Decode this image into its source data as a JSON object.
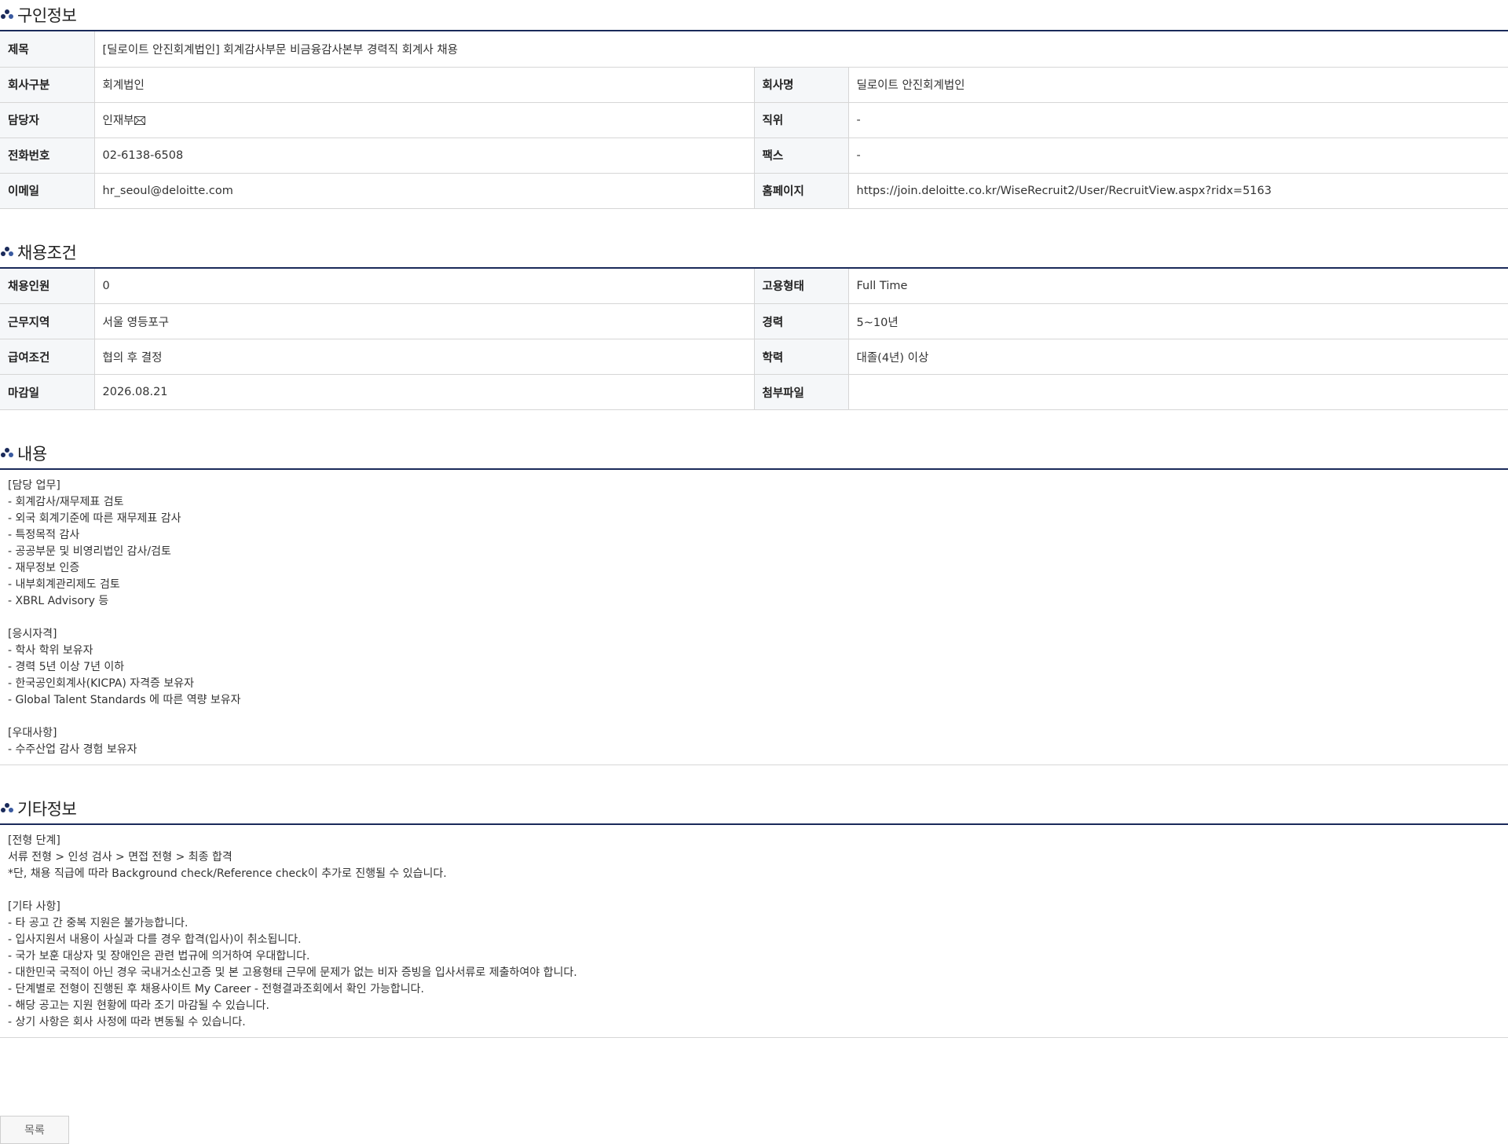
{
  "colors": {
    "accent": "#1a2a5a",
    "header_cell_bg": "#f5f7f9",
    "border": "#d6d6d6"
  },
  "icons": {
    "section_icon": "bullet-cluster-icon",
    "mail_icon": "envelope-icon"
  },
  "job_info": {
    "title": "구인정보",
    "rows": [
      {
        "label": "제목",
        "value": "[딜로이트 안진회계법인] 회계감사부문 비금융감사본부 경력직 회계사 채용"
      },
      {
        "label": "회사구분",
        "value": "회계법인",
        "label2": "회사명",
        "value2": "딜로이트 안진회계법인"
      },
      {
        "label": "담당자",
        "value": "인재부",
        "label2": "직위",
        "value2": "-"
      },
      {
        "label": "전화번호",
        "value": "02-6138-6508",
        "label2": "팩스",
        "value2": "-"
      },
      {
        "label": "이메일",
        "value": "hr_seoul@deloitte.com",
        "label2": "홈페이지",
        "value2": "https://join.deloitte.co.kr/WiseRecruit2/User/RecruitView.aspx?ridx=5163"
      }
    ]
  },
  "conditions": {
    "title": "채용조건",
    "rows": [
      {
        "label": "채용인원",
        "value": "0",
        "label2": "고용형태",
        "value2": "Full Time"
      },
      {
        "label": "근무지역",
        "value": "서울 영등포구",
        "label2": "경력",
        "value2": "5~10년"
      },
      {
        "label": "급여조건",
        "value": "협의 후 결정",
        "label2": "학력",
        "value2": "대졸(4년) 이상"
      },
      {
        "label": "마감일",
        "value": "2026.08.21",
        "label2": "첨부파일",
        "value2": ""
      }
    ]
  },
  "content": {
    "title": "내용",
    "lines": [
      "[담당 업무]",
      "- 회계감사/재무제표 검토",
      "- 외국 회계기준에 따른 재무제표 감사",
      "- 특정목적 감사",
      "- 공공부문 및 비영리법인 감사/검토",
      "- 재무정보 인증",
      "- 내부회계관리제도 검토",
      "- XBRL Advisory 등",
      "",
      "[응시자격]",
      "- 학사 학위 보유자",
      "- 경력 5년 이상 7년 이하",
      "- 한국공인회계사(KICPA) 자격증 보유자",
      "- Global Talent Standards 에 따른 역량 보유자",
      "",
      "[우대사항]",
      "- 수주산업 감사 경험 보유자"
    ]
  },
  "other": {
    "title": "기타정보",
    "lines": [
      "[전형 단계]",
      "서류 전형 > 인성 검사 > 면접 전형 > 최종 합격",
      "*단, 채용 직급에 따라 Background check/Reference check이 추가로 진행될 수 있습니다.",
      "",
      "[기타 사항]",
      "- 타 공고 간 중복 지원은 불가능합니다.",
      "- 입사지원서 내용이 사실과 다를 경우 합격(입사)이 취소됩니다.",
      "- 국가 보훈 대상자 및 장애인은 관련 법규에 의거하여 우대합니다.",
      "- 대한민국 국적이 아닌 경우 국내거소신고증 및 본 고용형태 근무에 문제가 없는 비자 증빙을 입사서류로 제출하여야 합니다.",
      "- 단계별로 전형이 진행된 후 채용사이트 My Career - 전형결과조회에서 확인 가능합니다.",
      "- 해당 공고는 지원 현황에 따라 조기 마감될 수 있습니다.",
      "- 상기 사항은 회사 사정에 따라 변동될 수 있습니다."
    ]
  },
  "buttons": {
    "list_label": "목록"
  }
}
